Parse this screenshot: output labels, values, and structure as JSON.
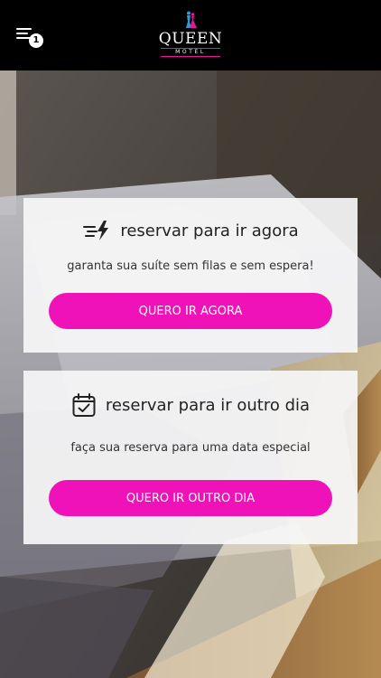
{
  "header": {
    "menu_icon": "menu-icon",
    "notification_count": "1",
    "logo": {
      "word": "QUEEN",
      "sub": "MOTEL"
    }
  },
  "cards": {
    "now": {
      "icon": "fast-forward-lightning-icon",
      "title": "reservar para ir agora",
      "description": "garanta sua suíte sem filas e sem espera!",
      "button_label": "QUERO IR AGORA"
    },
    "later": {
      "icon": "calendar-check-icon",
      "title": "reservar para ir outro dia",
      "description": "faça sua reserva para uma data especial",
      "button_label": "QUERO IR OUTRO DIA"
    }
  },
  "colors": {
    "accent": "#EE12B8",
    "topbar": "#000000",
    "card_background": "#F6F6F8"
  }
}
